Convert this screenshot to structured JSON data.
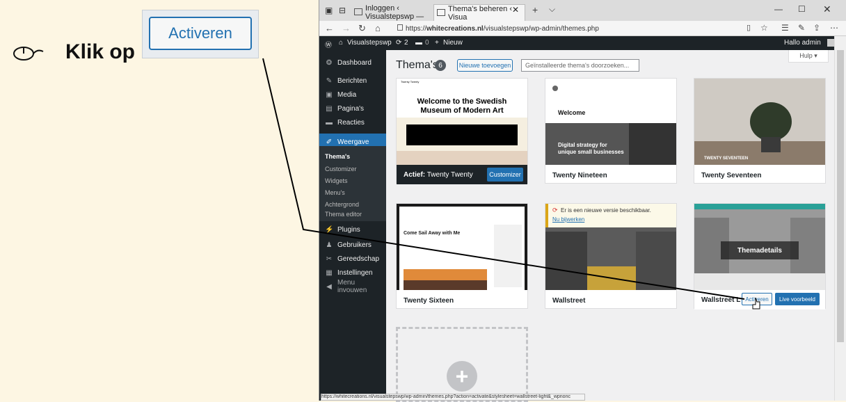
{
  "instruction": {
    "mouse_icon": "mouse-icon",
    "text": "Klik op",
    "zoom_button": "Activeren"
  },
  "browser": {
    "tabs": [
      {
        "label": "Inloggen ‹ Visualstepswp —",
        "active": false
      },
      {
        "label": "Thema's beheren ‹ Visua",
        "active": true
      }
    ],
    "close_glyph": "✕",
    "new_tab_glyph": "+",
    "url_prefix": "https://",
    "url_host": "whitecreations.nl",
    "url_path": "/visualstepswp/wp-admin/themes.php",
    "status_url": "https://whitecreations.nl/visualstepswp/wp-admin/themes.php?action=activate&stylesheet=wallstreet-light&_wpnonc"
  },
  "adminbar": {
    "site": "Visualstepswp",
    "updates": "2",
    "comments": "0",
    "new": "Nieuw",
    "greeting": "Hallo admin"
  },
  "sidebar": {
    "items": [
      {
        "label": "Dashboard",
        "icon": "dashboard-icon",
        "glyph": "❂"
      },
      {
        "label": "Berichten",
        "icon": "pin-icon",
        "glyph": "✎"
      },
      {
        "label": "Media",
        "icon": "media-icon",
        "glyph": "▣"
      },
      {
        "label": "Pagina's",
        "icon": "page-icon",
        "glyph": "▤"
      },
      {
        "label": "Reacties",
        "icon": "comment-icon",
        "glyph": "▬"
      },
      {
        "label": "Weergave",
        "icon": "brush-icon",
        "glyph": "✐"
      }
    ],
    "sub": [
      "Thema's",
      "Customizer",
      "Widgets",
      "Menu's",
      "Achtergrond",
      "Thema editor"
    ],
    "items2": [
      {
        "label": "Plugins",
        "icon": "plugin-icon",
        "glyph": "⚡"
      },
      {
        "label": "Gebruikers",
        "icon": "users-icon",
        "glyph": "♟"
      },
      {
        "label": "Gereedschap",
        "icon": "wrench-icon",
        "glyph": "✂"
      },
      {
        "label": "Instellingen",
        "icon": "settings-icon",
        "glyph": "▦"
      },
      {
        "label": "Menu invouwen",
        "icon": "collapse-icon",
        "glyph": "◀"
      }
    ]
  },
  "content": {
    "title": "Thema's",
    "count": "6",
    "add_new": "Nieuwe toevoegen",
    "search_placeholder": "Geïnstalleerde thema's doorzoeken...",
    "help": "Hulp ▾",
    "themes": [
      {
        "name": "Twenty Twenty",
        "active_prefix": "Actief:",
        "button": "Customizer",
        "shot_title": "Welcome to the Swedish Museum of Modern Art"
      },
      {
        "name": "Twenty Nineteen",
        "shot_title": "Welcome",
        "shot_sub": "Digital strategy for unique small businesses"
      },
      {
        "name": "Twenty Seventeen",
        "shot_title": "TWENTY SEVENTEEN"
      },
      {
        "name": "Twenty Sixteen",
        "shot_title": "Come Sail Away with Me"
      },
      {
        "name": "Wallstreet",
        "notice": "Er is een nieuwe versie beschikbaar.",
        "notice_link": "Nu bijwerken"
      },
      {
        "name": "Wallstreet L",
        "details": "Themadetails",
        "activate": "Activeren",
        "preview": "Live voorbeeld"
      }
    ]
  }
}
